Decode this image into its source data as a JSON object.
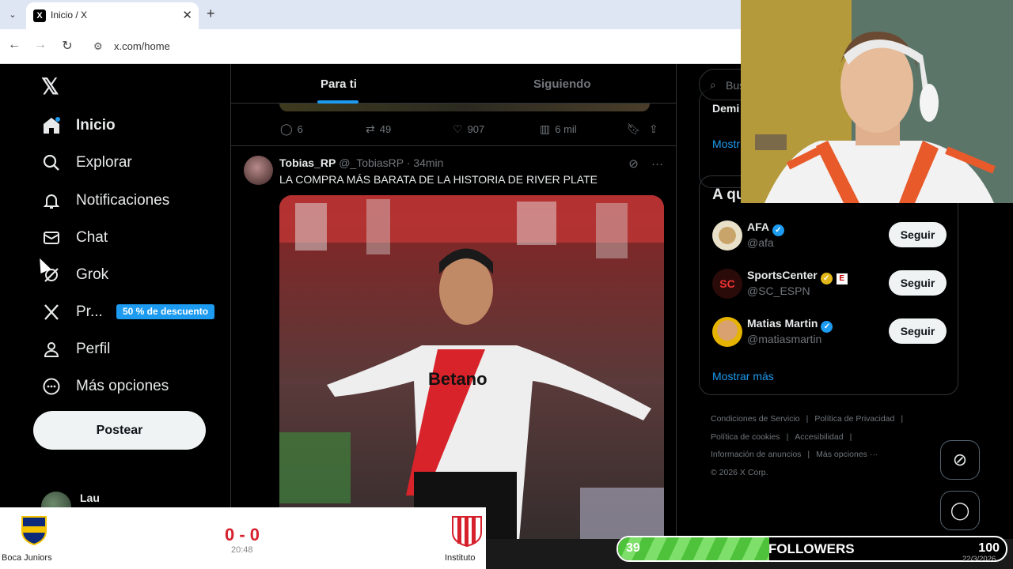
{
  "browser": {
    "tab_title": "Inicio / X",
    "url": "x.com/home"
  },
  "sidebar": {
    "items": [
      {
        "label": "Inicio",
        "icon": "home-icon"
      },
      {
        "label": "Explorar",
        "icon": "search-icon"
      },
      {
        "label": "Notificaciones",
        "icon": "bell-icon"
      },
      {
        "label": "Chat",
        "icon": "mail-icon"
      },
      {
        "label": "Grok",
        "icon": "grok-icon"
      },
      {
        "label": "Pr...",
        "icon": "x-premium-icon"
      },
      {
        "label": "Perfil",
        "icon": "person-icon"
      },
      {
        "label": "Más opciones",
        "icon": "more-circle-icon"
      }
    ],
    "promo_badge": "50 % de descuento",
    "post_button": "Postear",
    "account_name": "Lau"
  },
  "feed": {
    "tabs": [
      "Para ti",
      "Siguiendo"
    ],
    "prev_actions": {
      "replies": "6",
      "reposts": "49",
      "likes": "907",
      "views": "6 mil"
    },
    "tweet": {
      "name": "Tobias_RP",
      "handle_time": "@_TobiasRP · 34min",
      "text": "LA COMPRA MÁS BARATA DE LA HISTORIA DE RIVER PLATE"
    }
  },
  "right": {
    "search_placeholder": "Bus",
    "card1_title": "Demi",
    "card1_more": "Mostr",
    "card2_title": "A qu",
    "suggestions": [
      {
        "name": "AFA",
        "handle": "@afa",
        "button": "Seguir"
      },
      {
        "name": "SportsCenter",
        "handle": "@SC_ESPN",
        "button": "Seguir",
        "badge": "E"
      },
      {
        "name": "Matias Martin",
        "handle": "@matiasmartin",
        "button": "Seguir"
      }
    ],
    "show_more": "Mostrar más",
    "footer": [
      "Condiciones de Servicio",
      "|",
      "Política de Privacidad",
      "|",
      "Política de cookies",
      "Accesibilidad",
      "|",
      "Información de anuncios",
      "Más opciones ···",
      "© 2026 X Corp."
    ]
  },
  "scoreboard": {
    "home": "Boca Juniors",
    "away": "Instituto",
    "score": "0 - 0",
    "time": "20:48"
  },
  "followers": {
    "current": "39",
    "label": "FOLLOWERS",
    "goal": "100",
    "progress": 0.39,
    "date": "22/3/2026"
  },
  "colors": {
    "accent": "#1d9bf0",
    "bar_green": "#4ec23a",
    "score_red": "#d6202c"
  }
}
